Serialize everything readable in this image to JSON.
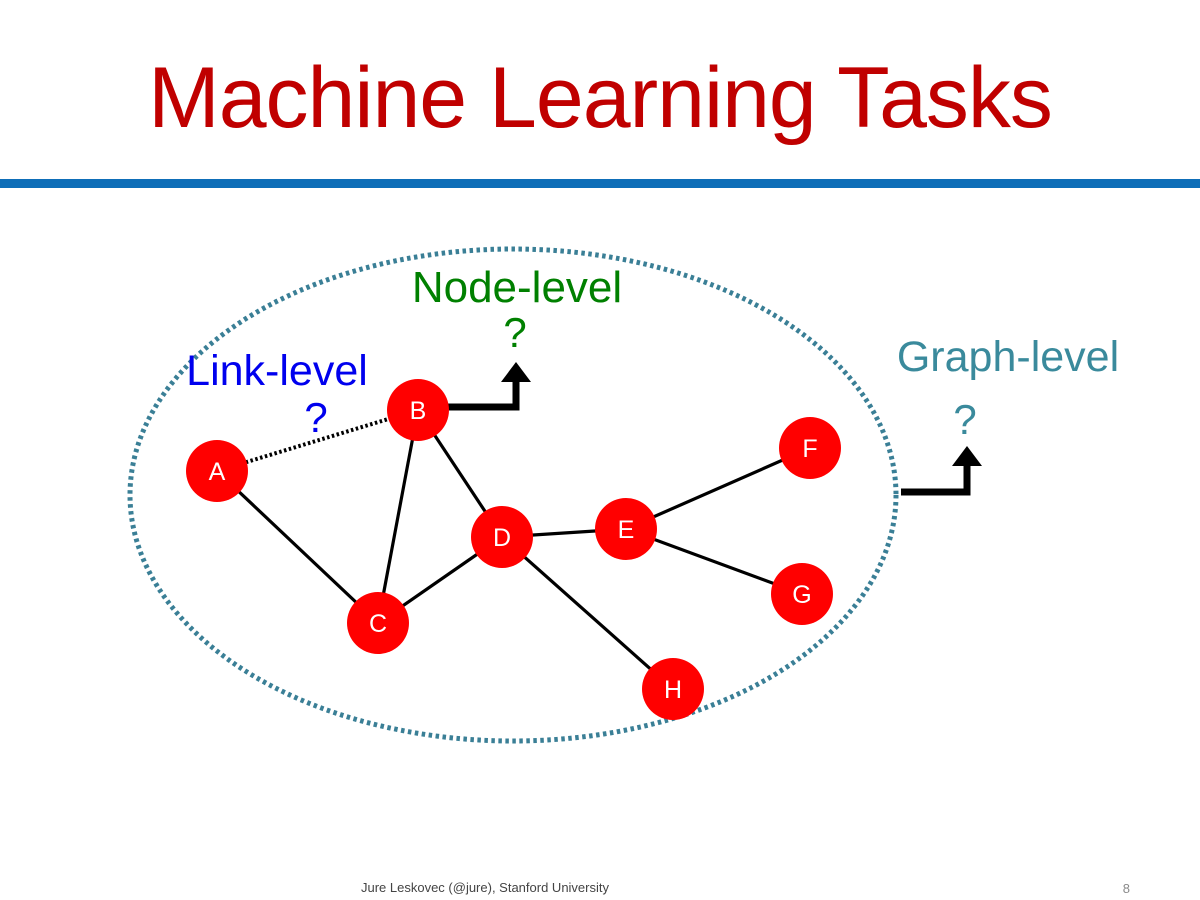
{
  "slide": {
    "title": "Machine Learning Tasks",
    "footer": "Jure Leskovec (@jure), Stanford University",
    "page_number": "8"
  },
  "labels": {
    "node_level": "Node-level",
    "link_level": "Link-level",
    "graph_level": "Graph-level",
    "question": "?"
  },
  "colors": {
    "title": "#c00000",
    "rule": "#0e6eb8",
    "node_fill": "#ff0000",
    "node_level": "#008000",
    "link_level": "#0000ee",
    "graph_level": "#3a8a9c",
    "boundary": "#3a7f96"
  },
  "nodes": [
    {
      "id": "A",
      "label": "A"
    },
    {
      "id": "B",
      "label": "B"
    },
    {
      "id": "C",
      "label": "C"
    },
    {
      "id": "D",
      "label": "D"
    },
    {
      "id": "E",
      "label": "E"
    },
    {
      "id": "F",
      "label": "F"
    },
    {
      "id": "G",
      "label": "G"
    },
    {
      "id": "H",
      "label": "H"
    }
  ],
  "edges": [
    {
      "from": "A",
      "to": "C",
      "style": "solid"
    },
    {
      "from": "B",
      "to": "C",
      "style": "solid"
    },
    {
      "from": "B",
      "to": "D",
      "style": "solid"
    },
    {
      "from": "C",
      "to": "D",
      "style": "solid"
    },
    {
      "from": "D",
      "to": "E",
      "style": "solid"
    },
    {
      "from": "E",
      "to": "F",
      "style": "solid"
    },
    {
      "from": "E",
      "to": "G",
      "style": "solid"
    },
    {
      "from": "D",
      "to": "H",
      "style": "solid"
    },
    {
      "from": "A",
      "to": "B",
      "style": "dotted"
    }
  ]
}
